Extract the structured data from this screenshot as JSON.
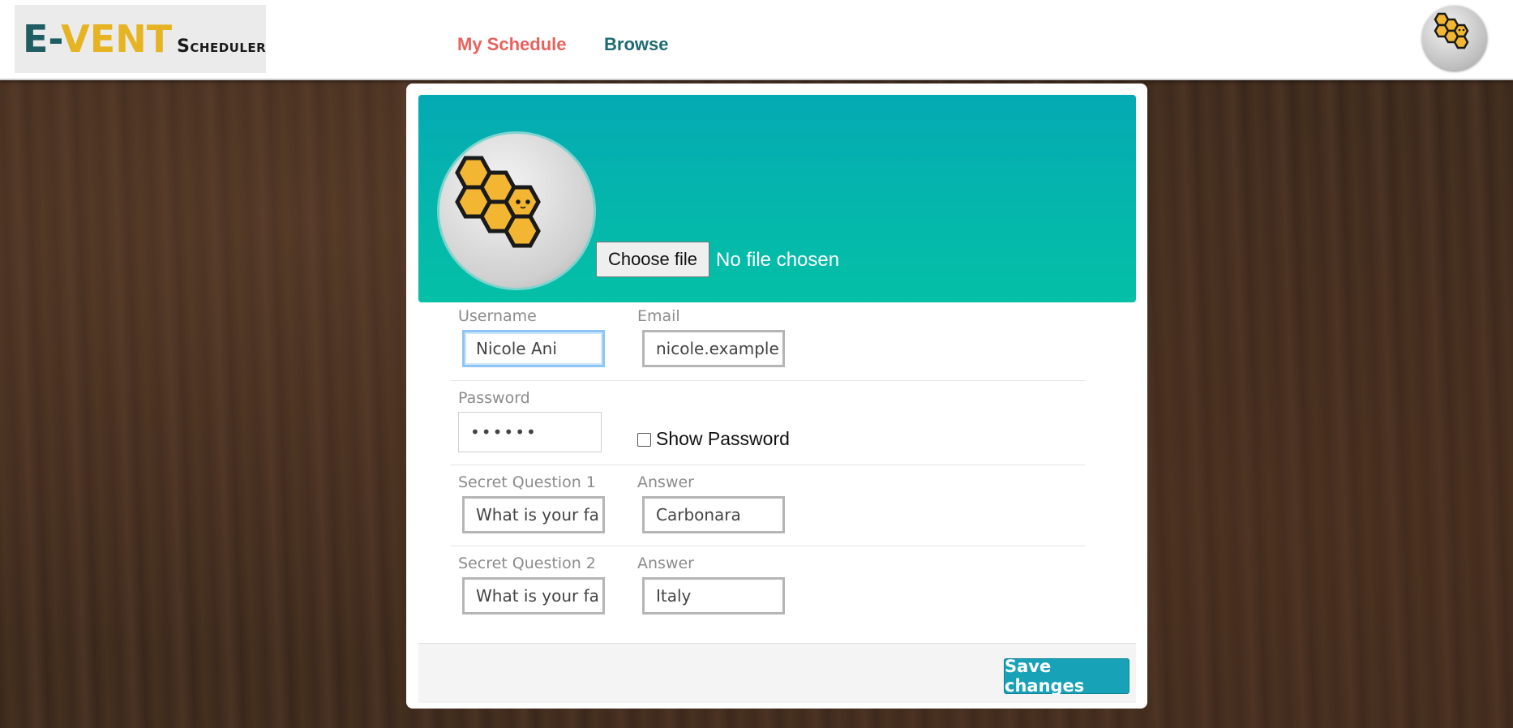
{
  "brand": {
    "logo_e": "E-",
    "logo_vent": "VENT",
    "logo_scheduler": "Scheduler"
  },
  "nav": {
    "items": [
      {
        "label": "My Schedule",
        "color": "#e8625d"
      },
      {
        "label": "Browse",
        "color": "#1e6b73"
      }
    ],
    "avatar_icon": "honeycomb-bee-icon"
  },
  "profile": {
    "picture_icon": "honeycomb-bee-icon",
    "file_button_label": "Choose file",
    "file_status": "No file chosen"
  },
  "form": {
    "username": {
      "label": "Username",
      "value": "Nicole Ani"
    },
    "email": {
      "label": "Email",
      "value": "nicole.example"
    },
    "password": {
      "label": "Password",
      "value": "••••••"
    },
    "show_password": {
      "label": "Show Password",
      "checked": false
    },
    "secret_question_1": {
      "label": "Secret Question 1",
      "value": "What is your fa"
    },
    "answer_1": {
      "label": "Answer",
      "value": "Carbonara"
    },
    "secret_question_2": {
      "label": "Secret Question 2",
      "value": "What is your fa"
    },
    "answer_2": {
      "label": "Answer",
      "value": "Italy"
    }
  },
  "footer": {
    "save_label": "Save changes"
  },
  "colors": {
    "banner_top": "#04aab3",
    "banner_bottom": "#04c0a6",
    "save_button": "#17a2b8",
    "honeycomb_fill": "#f2b632"
  }
}
